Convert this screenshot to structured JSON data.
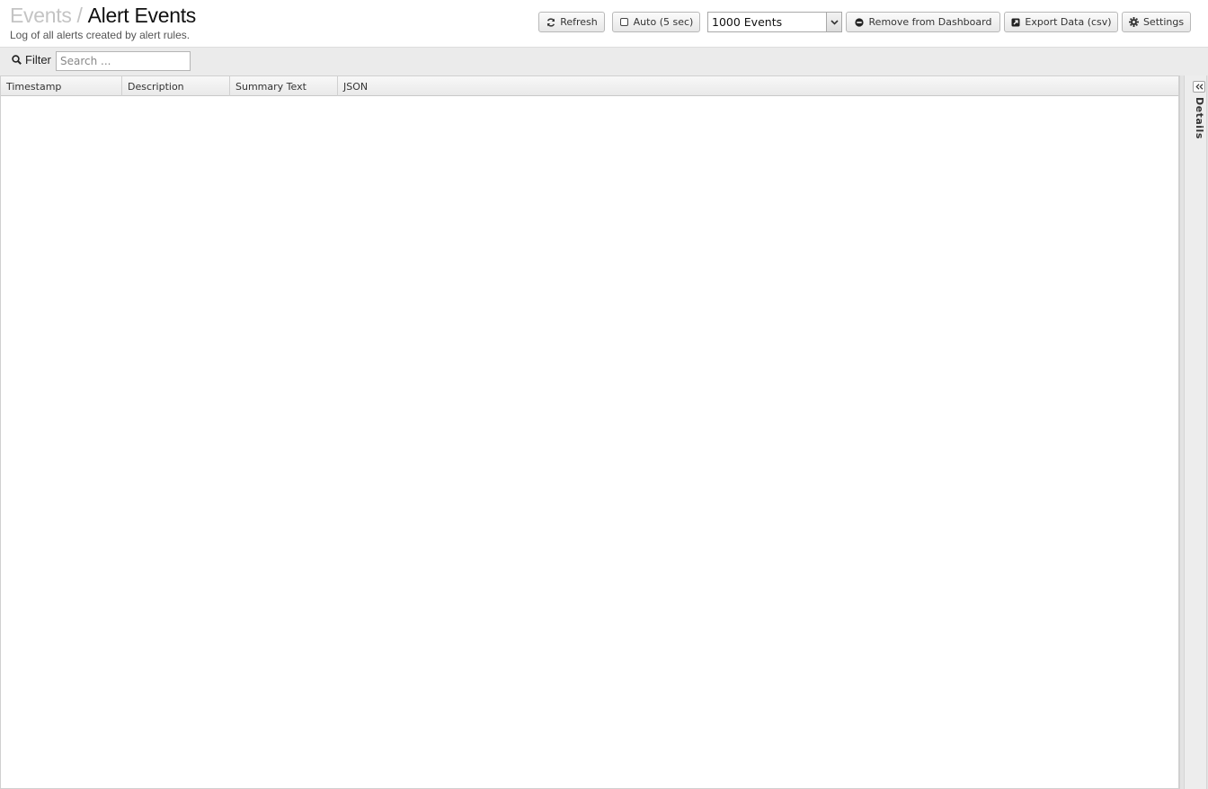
{
  "header": {
    "breadcrumb_parent": "Events",
    "breadcrumb_separator": "/",
    "title": "Alert Events",
    "subtitle": "Log of all alerts created by alert rules."
  },
  "toolbar": {
    "refresh_label": "Refresh",
    "auto_label": "Auto (5 sec)",
    "auto_checked": false,
    "events_select_value": "1000 Events",
    "remove_label": "Remove from Dashboard",
    "export_label": "Export Data (csv)",
    "settings_label": "Settings"
  },
  "filter": {
    "label": "Filter",
    "placeholder": "Search ...",
    "value": ""
  },
  "table": {
    "columns": [
      "Timestamp",
      "Description",
      "Summary Text",
      "JSON"
    ],
    "rows": []
  },
  "details_panel": {
    "label": "Details"
  },
  "icons": {
    "refresh": "refresh-icon",
    "checkbox": "checkbox-icon",
    "dropdown": "chevron-down-icon",
    "remove": "minus-circle-icon",
    "export": "external-link-icon",
    "settings": "gear-icon",
    "search": "search-icon",
    "collapse": "double-chevron-left-icon"
  }
}
